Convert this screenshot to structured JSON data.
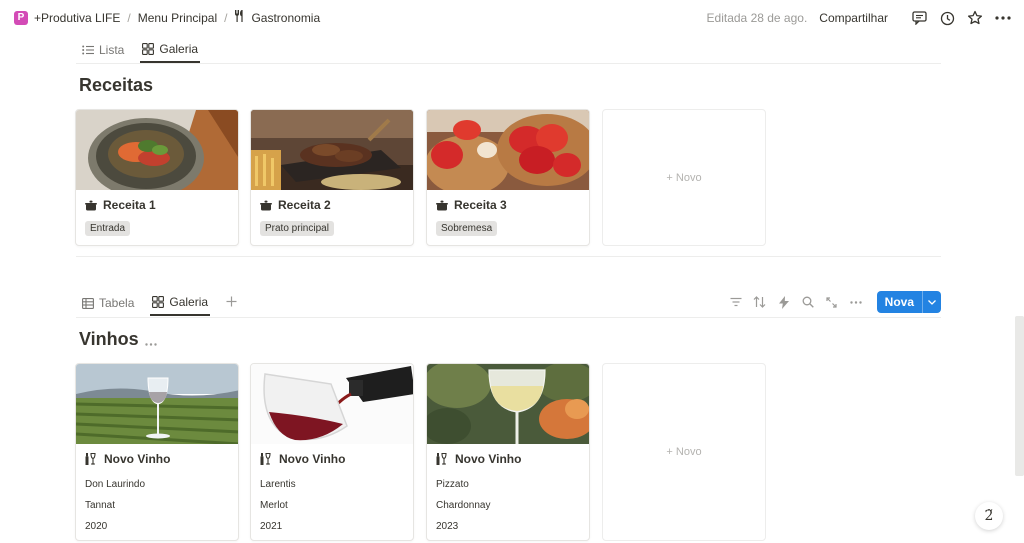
{
  "breadcrumb": {
    "workspace": "+Produtiva LIFE",
    "parent": "Menu Principal",
    "current": "Gastronomia"
  },
  "topbar": {
    "edited": "Editada 28 de ago.",
    "share": "Compartilhar"
  },
  "receitas": {
    "tabs": [
      "Lista",
      "Galeria"
    ],
    "title": "Receitas",
    "new_label": "+ Novo",
    "cards": [
      {
        "title": "Receita 1",
        "tag": "Entrada"
      },
      {
        "title": "Receita 2",
        "tag": "Prato principal"
      },
      {
        "title": "Receita 3",
        "tag": "Sobremesa"
      }
    ]
  },
  "vinhos": {
    "tabs": [
      "Tabela",
      "Galeria"
    ],
    "title": "Vinhos",
    "new_button": "Nova",
    "new_label": "+ Novo",
    "cards": [
      {
        "title": "Novo Vinho",
        "producer": "Don Laurindo",
        "grape": "Tannat",
        "year": "2020"
      },
      {
        "title": "Novo Vinho",
        "producer": "Larentis",
        "grape": "Merlot",
        "year": "2021"
      },
      {
        "title": "Novo Vinho",
        "producer": "Pizzato",
        "grape": "Chardonnay",
        "year": "2023"
      }
    ]
  },
  "colors": {
    "accent": "#2383e2",
    "app_icon": "#d34bb6",
    "tag_bg": "#e3e2e0"
  }
}
